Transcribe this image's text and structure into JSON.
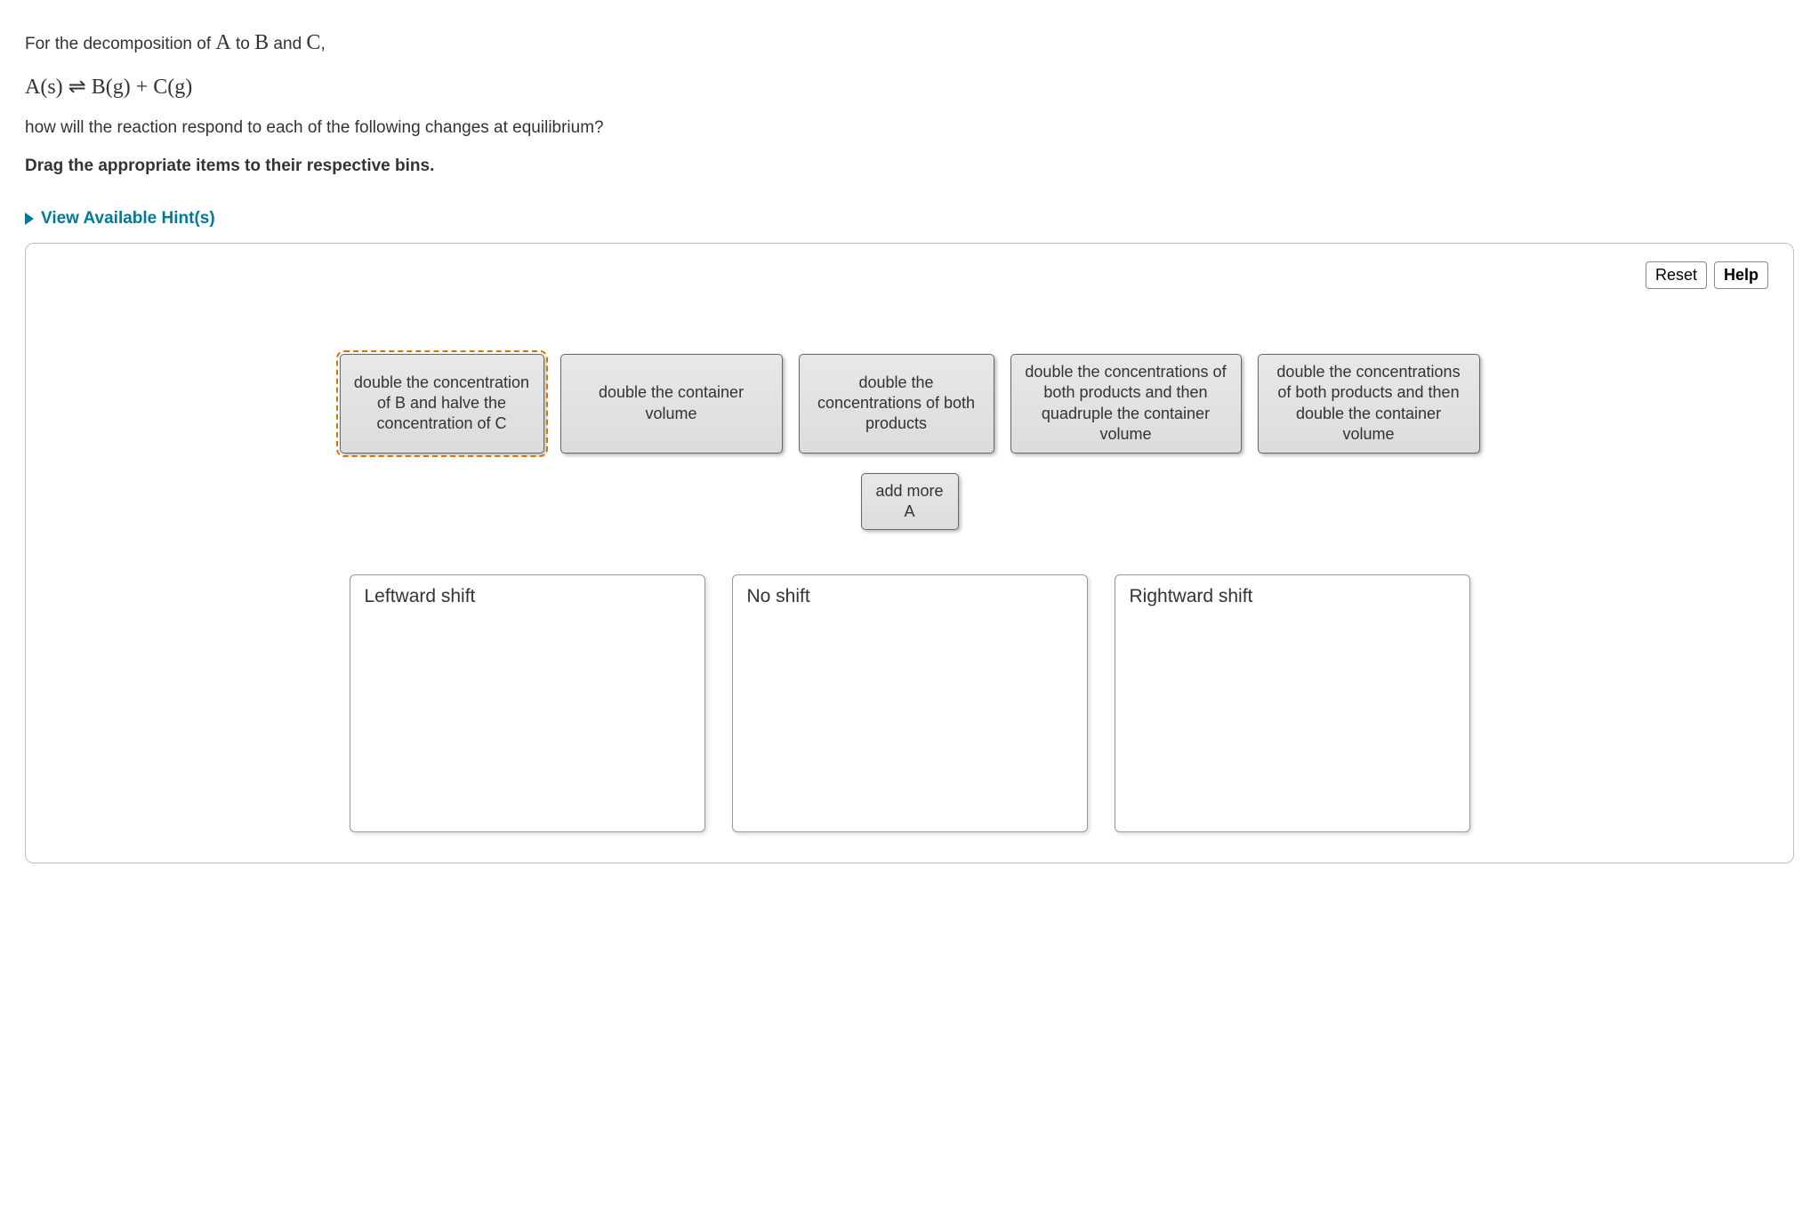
{
  "prompt": {
    "line1_pre": "For the decomposition of ",
    "line1_A": "A",
    "line1_mid1": " to ",
    "line1_B": "B",
    "line1_mid2": " and ",
    "line1_C": "C",
    "line1_post": ",",
    "equation": "A(s) ⇌ B(g) + C(g)",
    "line2": "how will the reaction respond to each of the following changes at equilibrium?",
    "instruction": "Drag the appropriate items to their respective bins."
  },
  "hints_label": "View Available Hint(s)",
  "toolbar": {
    "reset": "Reset",
    "help": "Help"
  },
  "draggables": {
    "item1": "double the concentration of B and halve the concentration of C",
    "item2": "double the container volume",
    "item3": "double the concentrations of both products",
    "item4": "double the concentrations of both products and then quadruple the container volume",
    "item5": "double the concentrations of both products and then double the container volume",
    "item6": "add more A"
  },
  "bins": {
    "left": "Leftward shift",
    "none": "No shift",
    "right": "Rightward shift"
  }
}
